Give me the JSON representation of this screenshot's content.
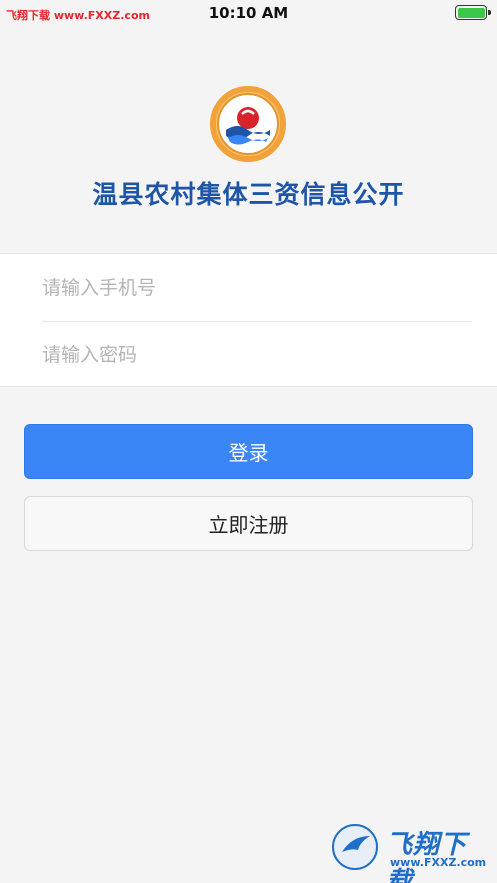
{
  "status_bar": {
    "watermark": "飞翔下载 www.FXXZ.com",
    "time": "10:10 AM",
    "battery_level": 1.0,
    "battery_color": "#3ac74a"
  },
  "header": {
    "title": "温县农村集体三资信息公开",
    "title_color": "#1f55a6",
    "logo_icon": "circular-emblem-logo"
  },
  "form": {
    "phone_placeholder": "请输入手机号",
    "password_placeholder": "请输入密码"
  },
  "actions": {
    "login_label": "登录",
    "login_color": "#3a86f6",
    "register_label": "立即注册"
  },
  "watermark_bottom": {
    "text": "飞翔下载",
    "url": "www.FXXZ.com"
  }
}
